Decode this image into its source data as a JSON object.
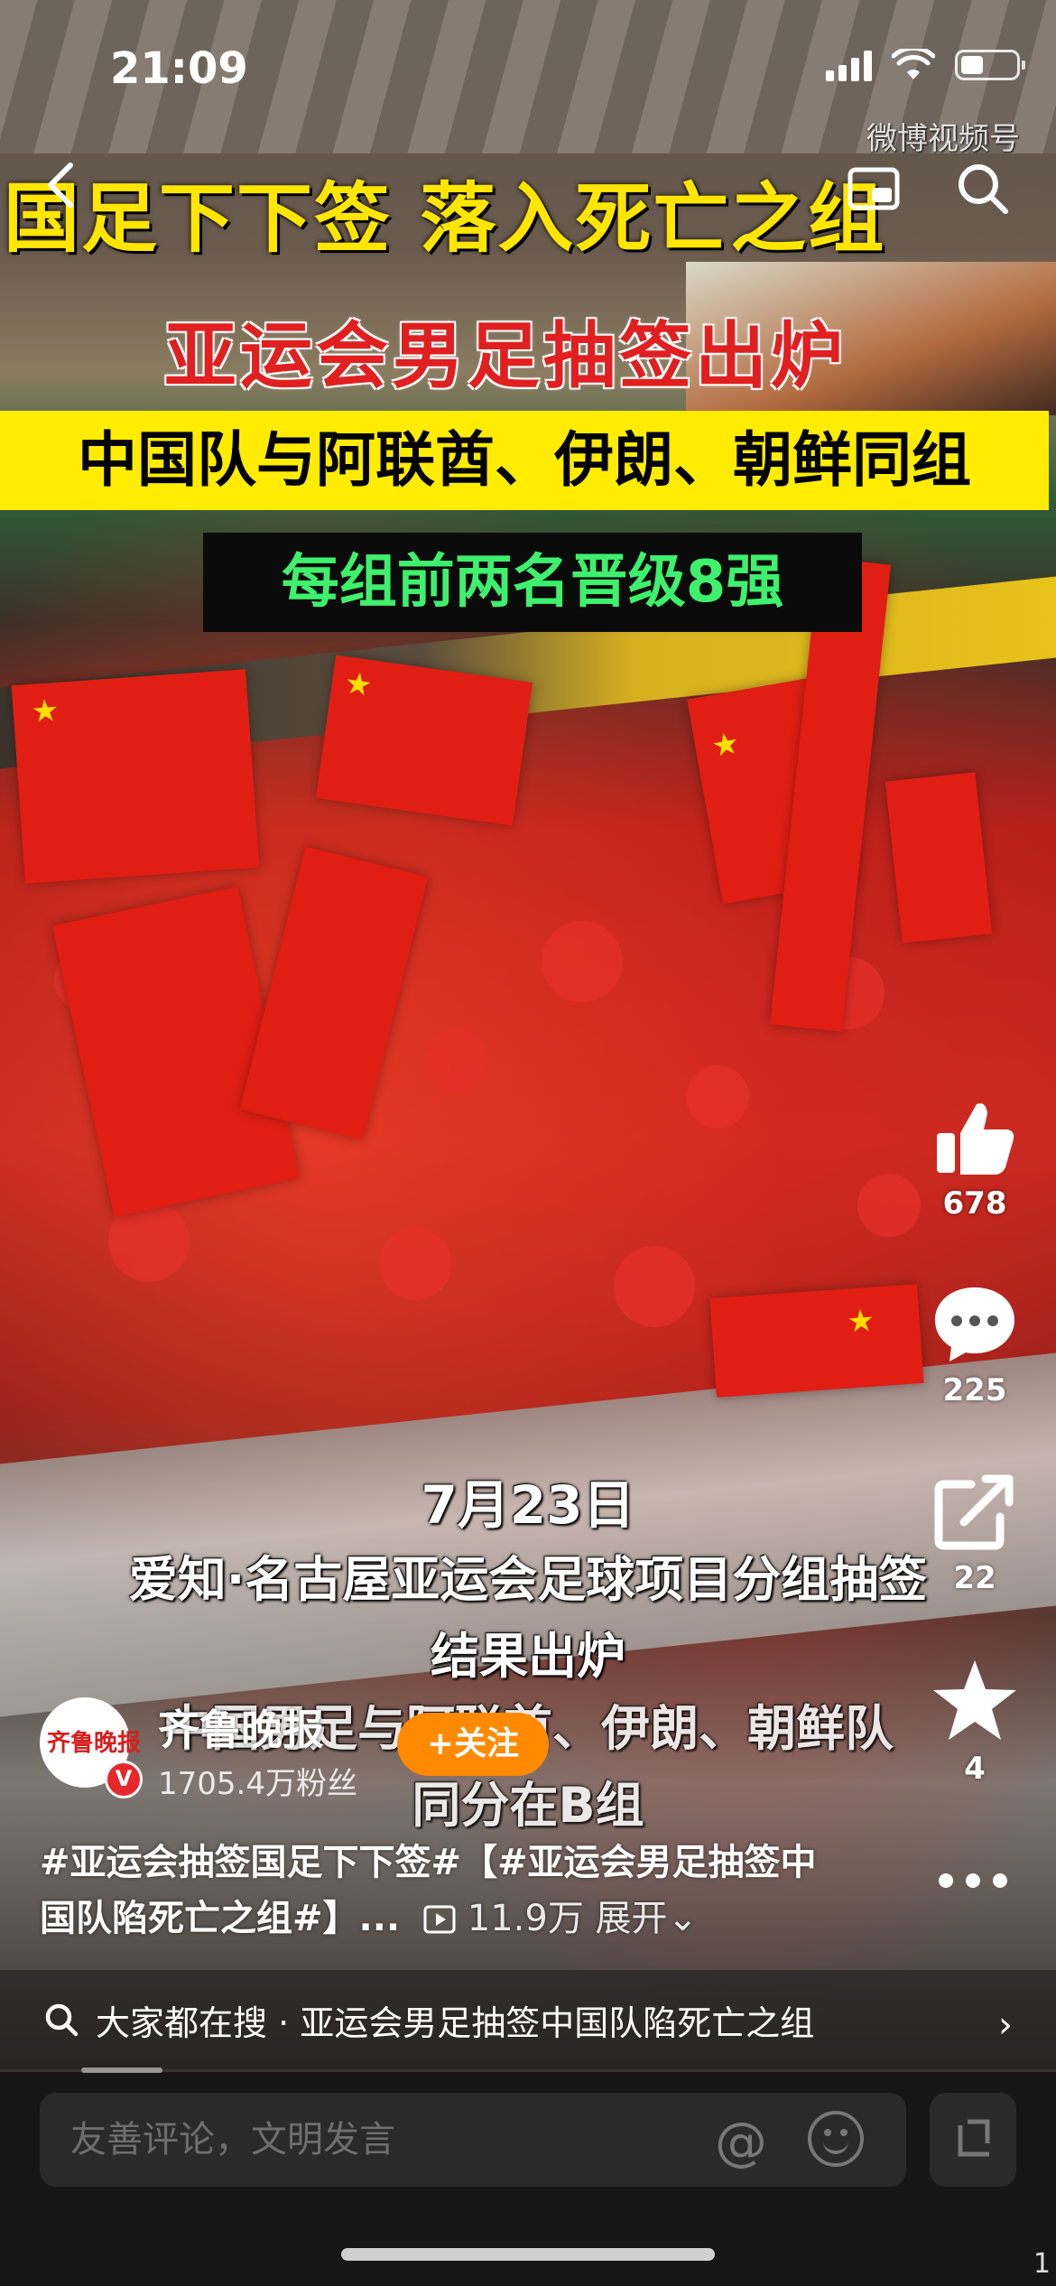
{
  "status_bar": {
    "time": "21:09"
  },
  "watermark": "微博视频号",
  "captions": {
    "line1": "国足下下签 落入死亡之组",
    "line2": "亚运会男足抽签出炉",
    "line3": "中国队与阿联酋、伊朗、朝鲜同组",
    "line4": "每组前两名晋级8强"
  },
  "subtitles": {
    "date": "7月23日",
    "line2": "爱知·名古屋亚运会足球项目分组抽签",
    "line3": "结果出炉",
    "line4": "中国男足与阿联酋、伊朗、朝鲜队",
    "line5": "同分在B组"
  },
  "actions": {
    "like_count": "678",
    "comment_count": "225",
    "share_count": "22",
    "favorite_count": "4"
  },
  "author": {
    "name": "齐鲁晚报",
    "fans": "1705.4万粉丝",
    "avatar_text": "齐鲁晚报",
    "verified_badge": "V",
    "follow_label": "+关注"
  },
  "description": {
    "text": "#亚运会抽签国足下下签#【#亚运会男足抽签中国队陷死亡之组#】...",
    "views": "11.9万",
    "expand_label": "展开"
  },
  "hot_search": {
    "text": "大家都在搜 · 亚运会男足抽签中国队陷死亡之组"
  },
  "comment_bar": {
    "placeholder": "友善评论，文明发言"
  },
  "corner_number": "1",
  "colors": {
    "follow": "#ff8a00",
    "caption_yellow": "#ffe600",
    "caption_red": "#e02020",
    "caption_green": "#3ef06c"
  }
}
